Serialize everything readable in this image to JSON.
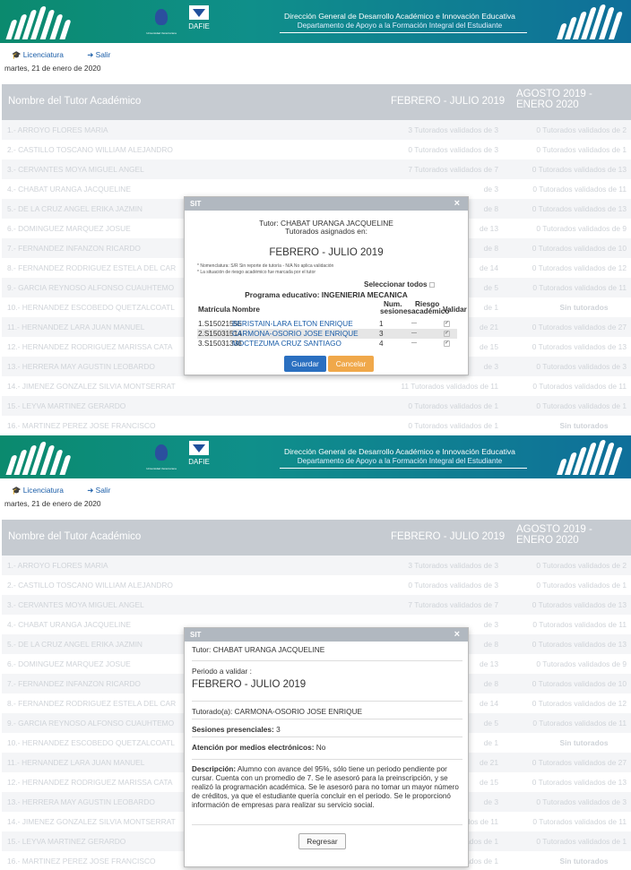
{
  "banner": {
    "title_line1": "Dirección General de Desarrollo Académico e Innovación Educativa",
    "title_line2": "Departamento de Apoyo a la Formación Integral del Estudiante",
    "dafie_label": "DAFIE",
    "university_caption": "Universidad Veracruzana"
  },
  "nav": {
    "licenciatura_label": "Licenciatura",
    "salir_label": "Salir"
  },
  "date_text": "martes, 21 de enero de 2020",
  "table": {
    "col_tutor": "Nombre del Tutor Académico",
    "col_period1": "FEBRERO - JULIO 2019",
    "col_period2": "AGOSTO 2019 - ENERO 2020",
    "rows": [
      {
        "name": "1.- ARROYO FLORES MARIA",
        "p1": "3 Tutorados validados de 3",
        "p2": "0 Tutorados validados de 2"
      },
      {
        "name": "2.- CASTILLO TOSCANO WILLIAM ALEJANDRO",
        "p1": "0 Tutorados validados de 3",
        "p2": "0 Tutorados validados de 1"
      },
      {
        "name": "3.- CERVANTES MOYA MIGUEL ANGEL",
        "p1": "7 Tutorados validados de 7",
        "p2": "0 Tutorados validados de 13"
      },
      {
        "name": "4.- CHABAT URANGA JACQUELINE",
        "p1": "de 3",
        "p2": "0 Tutorados validados de 11"
      },
      {
        "name": "5.- DE LA CRUZ ANGEL ERIKA JAZMIN",
        "p1": "de 8",
        "p2": "0 Tutorados validados de 13"
      },
      {
        "name": "6.- DOMINGUEZ MARQUEZ JOSUE",
        "p1": "de 13",
        "p2": "0 Tutorados validados de 9"
      },
      {
        "name": "7.- FERNANDEZ INFANZON RICARDO",
        "p1": "de 8",
        "p2": "0 Tutorados validados de 10"
      },
      {
        "name": "8.- FERNANDEZ RODRIGUEZ ESTELA DEL CAR",
        "p1": "de 14",
        "p2": "0 Tutorados validados de 12"
      },
      {
        "name": "9.- GARCIA REYNOSO ALFONSO CUAUHTEMO",
        "p1": "de 5",
        "p2": "0 Tutorados validados de 11"
      },
      {
        "name": "10.- HERNANDEZ ESCOBEDO QUETZALCOATL",
        "p1": "de 1",
        "p2": "Sin tutorados"
      },
      {
        "name": "11.- HERNANDEZ LARA JUAN MANUEL",
        "p1": "de 21",
        "p2": "0 Tutorados validados de 27"
      },
      {
        "name": "12.- HERNANDEZ RODRIGUEZ MARISSA CATA",
        "p1": "de 15",
        "p2": "0 Tutorados validados de 13"
      },
      {
        "name": "13.- HERRERA MAY AGUSTIN LEOBARDO",
        "p1": "de 3",
        "p2": "0 Tutorados validados de 3"
      },
      {
        "name": "14.- JIMENEZ GONZALEZ SILVIA MONTSERRAT",
        "p1": "11 Tutorados validados de 11",
        "p2": "0 Tutorados validados de 11"
      },
      {
        "name": "15.- LEYVA MARTINEZ GERARDO",
        "p1": "0 Tutorados validados de 1",
        "p2": "0 Tutorados validados de 1"
      },
      {
        "name": "16.- MARTINEZ PEREZ JOSE FRANCISCO",
        "p1": "0 Tutorados validados de 1",
        "p2": "Sin tutorados"
      }
    ]
  },
  "modal1": {
    "title": "SIT",
    "close": "×",
    "tutor_line": "Tutor: CHABAT URANGA JACQUELINE",
    "assigned_line": "Tutorados asignados en:",
    "period": "FEBRERO - JULIO 2019",
    "note1": "* Nomenclatura: S/R Sin reporte de tutoría - N/A No aplica validación",
    "note2": "* La situación de riesgo académico fue marcada por el tutor",
    "select_all": "Seleccionar todos",
    "program": "Programa educativo: INGENIERIA MECANICA",
    "col_matricula": "Matrícula",
    "col_nombre": "Nombre",
    "col_sesiones_1": "Num.",
    "col_sesiones_2": "sesiones",
    "col_riesgo_1": "Riesgo",
    "col_riesgo_2": "académico",
    "col_validar": "Validar",
    "students": [
      {
        "matricula": "1.S15021556",
        "nombre": "BERISTAIN-LARA ELTON ENRIQUE",
        "sesiones": "1",
        "riesgo": "---",
        "validar": "✔"
      },
      {
        "matricula": "2.S15031514",
        "nombre": "CARMONA-OSORIO JOSE ENRIQUE",
        "sesiones": "3",
        "riesgo": "---",
        "validar": "✔"
      },
      {
        "matricula": "3.S15031338",
        "nombre": "MOCTEZUMA CRUZ SANTIAGO",
        "sesiones": "4",
        "riesgo": "---",
        "validar": "✔"
      }
    ],
    "save_label": "Guardar",
    "cancel_label": "Cancelar"
  },
  "modal2": {
    "title": "SIT",
    "close": "×",
    "tutor_line": "Tutor: CHABAT URANGA JACQUELINE",
    "period_label": "Periodo a validar :",
    "period": "FEBRERO - JULIO 2019",
    "tutorado": "Tutorado(a): CARMONA-OSORIO JOSE ENRIQUE",
    "sesiones_label": "Sesiones presenciales:",
    "sesiones_value": "3",
    "medios_label": "Atención por medios electrónicos:",
    "medios_value": "No",
    "desc_label": "Descripción:",
    "desc_text": "Alumno con avance del 95%, sólo tiene un periodo pendiente por cursar. Cuenta con un promedio de 7. Se le asesoró para la preinscripción, y se realizó la programación académica. Se le asesoró para no tomar un mayor número de créditos, ya que el estudiante quería concluir en el periodo. Se le proporcionó información de empresas para realizar su servicio social.",
    "back_label": "Regresar"
  },
  "colors": {
    "banner": "#0b8a6e",
    "table_header": "#c6cbd1",
    "link": "#1a5da8",
    "save_button": "#2a6fc0",
    "cancel_button": "#f0a84a"
  }
}
